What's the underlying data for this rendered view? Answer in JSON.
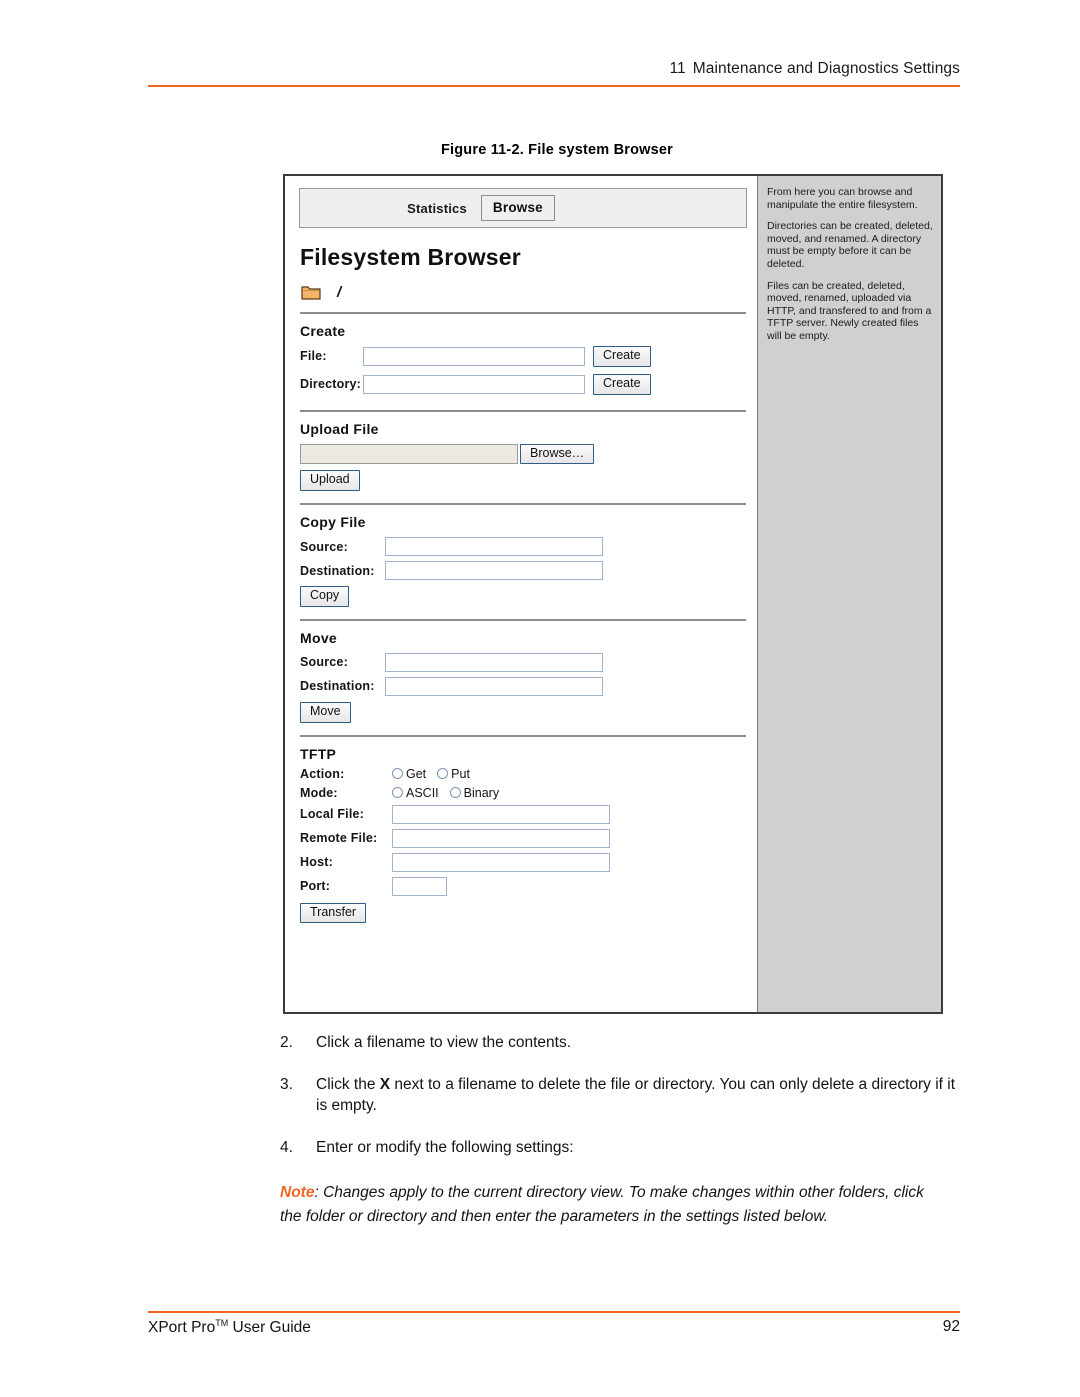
{
  "header": {
    "chapter_number": "11",
    "chapter_title": "Maintenance and Diagnostics Settings"
  },
  "figure": {
    "caption": "Figure 11-2. File system Browser"
  },
  "screenshot": {
    "tabs": {
      "statistics_label": "Statistics",
      "browse_label": "Browse"
    },
    "title": "Filesystem Browser",
    "path": "/",
    "folder_icon": "folder-icon",
    "create": {
      "heading": "Create",
      "file_label": "File:",
      "file_value": "",
      "file_button": "Create",
      "directory_label": "Directory:",
      "directory_value": "",
      "directory_button": "Create"
    },
    "upload": {
      "heading": "Upload File",
      "file_value": "",
      "browse_button": "Browse…",
      "upload_button": "Upload"
    },
    "copy": {
      "heading": "Copy File",
      "source_label": "Source:",
      "source_value": "",
      "destination_label": "Destination:",
      "destination_value": "",
      "copy_button": "Copy"
    },
    "move": {
      "heading": "Move",
      "source_label": "Source:",
      "source_value": "",
      "destination_label": "Destination:",
      "destination_value": "",
      "move_button": "Move"
    },
    "tftp": {
      "heading": "TFTP",
      "action_label": "Action:",
      "action_get": "Get",
      "action_put": "Put",
      "mode_label": "Mode:",
      "mode_ascii": "ASCII",
      "mode_binary": "Binary",
      "local_file_label": "Local File:",
      "local_file_value": "",
      "remote_file_label": "Remote File:",
      "remote_file_value": "",
      "host_label": "Host:",
      "host_value": "",
      "port_label": "Port:",
      "port_value": "",
      "transfer_button": "Transfer"
    },
    "help": {
      "p1": "From here you can browse and manipulate the entire filesystem.",
      "p2": "Directories can be created, deleted, moved, and renamed. A directory must be empty before it can be deleted.",
      "p3": "Files can be created, deleted, moved, renamed, uploaded via HTTP, and transfered to and from a TFTP server. Newly created files will be empty."
    }
  },
  "steps": [
    {
      "num": "2.",
      "text": "Click a filename to view the contents."
    },
    {
      "num": "3.",
      "text_before": "Click the ",
      "bold": "X",
      "text_after": " next to a filename to delete the file or directory. You can only delete a directory if it is empty."
    },
    {
      "num": "4.",
      "text": "Enter or modify the following settings:"
    }
  ],
  "note": {
    "label": "Note",
    "text": ": Changes apply to the current directory view. To make changes within other folders, click the folder or directory and then enter the parameters in the settings listed below."
  },
  "footer": {
    "guide_name_before": "XPort Pro",
    "trademark": "TM",
    "guide_name_after": " User Guide",
    "page_number": "92"
  },
  "colors": {
    "accent": "#f26522",
    "sidebar": "#d0d0d0"
  }
}
